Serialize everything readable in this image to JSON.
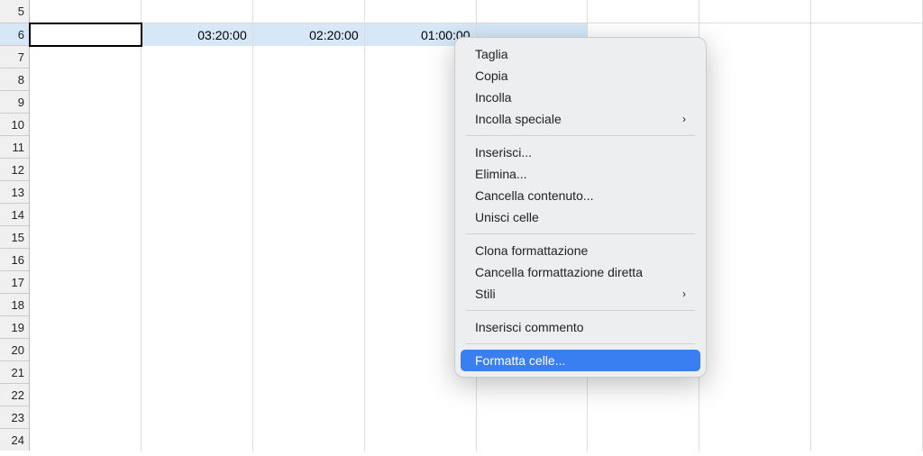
{
  "rows": [
    "5",
    "6",
    "7",
    "8",
    "9",
    "10",
    "11",
    "12",
    "13",
    "14",
    "15",
    "16",
    "17",
    "18",
    "19",
    "20",
    "21",
    "22",
    "23",
    "24"
  ],
  "selected_row_index": 1,
  "cells": {
    "r1c1": "03:20:00",
    "r1c2": "02:20:00",
    "r1c3": "01:00:00"
  },
  "menu": {
    "cut": "Taglia",
    "copy": "Copia",
    "paste": "Incolla",
    "paste_special": "Incolla speciale",
    "insert": "Inserisci...",
    "delete": "Elimina...",
    "clear_content": "Cancella contenuto...",
    "merge_cells": "Unisci celle",
    "clone_format": "Clona formattazione",
    "clear_direct_format": "Cancella formattazione diretta",
    "styles": "Stili",
    "insert_comment": "Inserisci commento",
    "format_cells": "Formatta celle..."
  }
}
